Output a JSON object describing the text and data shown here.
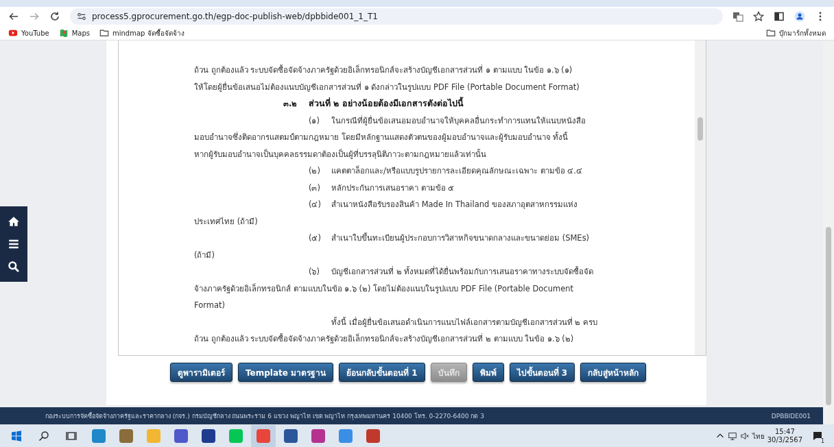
{
  "browser": {
    "url": "process5.gprocurement.go.th/egp-doc-publish-web/dpbbide001_1_T1",
    "bookmarks": [
      {
        "label": "YouTube",
        "kind": "youtube"
      },
      {
        "label": "Maps",
        "kind": "maps"
      },
      {
        "label": "mindmap จัดซื้อจัดจ้าง",
        "kind": "folder"
      }
    ],
    "all_bookmarks": "บุ๊กมาร์กทั้งหมด"
  },
  "document": {
    "lines": [
      {
        "kind": "flush",
        "text": "ถ้วน ถูกต้องแล้ว ระบบจัดซื้อจัดจ้างภาครัฐด้วยอิเล็กทรอนิกส์จะสร้างบัญชีเอกสารส่วนที่ ๑ ตามแบบ ในข้อ ๑.๖ (๑)"
      },
      {
        "kind": "flush",
        "text": "ให้โดยผู้ยื่นข้อเสนอไม่ต้องแนบบัญชีเอกสารส่วนที่ ๑ ดังกล่าวในรูปแบบ PDF File (Portable Document Format)"
      },
      {
        "kind": "heading",
        "number": "๓.๒",
        "text": "ส่วนที่ ๒ อย่างน้อยต้องมีเอกสารดังต่อไปนี้"
      },
      {
        "kind": "item",
        "number": "(๑)",
        "text": "ในกรณีที่ผู้ยื่นข้อเสนอมอบอำนาจให้บุคคลอื่นกระทำการแทนให้แนบหนังสือ"
      },
      {
        "kind": "flush",
        "text": "มอบอำนาจซึ่งติดอากรแสตมป์ตามกฎหมาย โดยมีหลักฐานแสดงตัวตนของผู้มอบอำนาจและผู้รับมอบอำนาจ ทั้งนี้"
      },
      {
        "kind": "flush",
        "text": "หากผู้รับมอบอำนาจเป็นบุคคลธรรมดาต้องเป็นผู้ที่บรรลุนิติภาวะตามกฎหมายแล้วเท่านั้น"
      },
      {
        "kind": "item",
        "number": "(๒)",
        "text": "แคตตาล็อกและ/หรือแบบรูปรายการละเอียดคุณลักษณะเฉพาะ ตามข้อ ๔.๔"
      },
      {
        "kind": "item",
        "number": "(๓)",
        "text": "หลักประกันการเสนอราคา ตามข้อ ๕"
      },
      {
        "kind": "item",
        "number": "(๔)",
        "text": "สำเนาหนังสือรับรองสินค้า Made In Thailand ของสภาอุตสาหกรรมแห่ง"
      },
      {
        "kind": "flush",
        "text": "ประเทศไทย (ถ้ามี)"
      },
      {
        "kind": "item",
        "number": "(๕)",
        "text": "สำเนาใบขึ้นทะเบียนผู้ประกอบการวิสาหกิจขนาดกลางและขนาดย่อม (SMEs)"
      },
      {
        "kind": "flush",
        "text": "(ถ้ามี)"
      },
      {
        "kind": "item",
        "number": "(๖)",
        "text": "บัญชีเอกสารส่วนที่ ๒ ทั้งหมดที่ได้ยื่นพร้อมกับการเสนอราคาทางระบบจัดซื้อจัด"
      },
      {
        "kind": "flush",
        "text": "จ้างภาครัฐด้วยอิเล็กทรอนิกส์ ตามแบบในข้อ ๑.๖ (๒) โดยไม่ต้องแนบในรูปแบบ PDF File (Portable Document"
      },
      {
        "kind": "flush",
        "text": "Format)"
      },
      {
        "kind": "indent",
        "text": "ทั้งนี้ เมื่อผู้ยื่นข้อเสนอดำเนินการแนบไฟล์เอกสารตามบัญชีเอกสารส่วนที่ ๒ ครบ"
      },
      {
        "kind": "flush",
        "text": "ถ้วน ถูกต้องแล้ว ระบบจัดซื้อจัดจ้างภาครัฐด้วยอิเล็กทรอนิกส์จะสร้างบัญชีเอกสารส่วนที่ ๒ ตามแบบ ในข้อ ๑.๖ (๒)"
      }
    ]
  },
  "buttons": [
    {
      "label": "ดูพารามิเตอร์",
      "disabled": false
    },
    {
      "label": "Template มาตรฐาน",
      "disabled": false
    },
    {
      "label": "ย้อนกลับขั้นตอนที่ 1",
      "disabled": false
    },
    {
      "label": "บันทึก",
      "disabled": true
    },
    {
      "label": "พิมพ์",
      "disabled": false
    },
    {
      "label": "ไปขั้นตอนที่ 3",
      "disabled": false
    },
    {
      "label": "กลับสู่หน้าหลัก",
      "disabled": false
    }
  ],
  "footer": {
    "address": "กองระบบการจัดซื้อจัดจ้างภาครัฐและราคากลาง (กจร.) กรมบัญชีกลาง ถนนพระราม 6 แขวง พญาไท เขต พญาไท กรุงเทพมหานคร 10400 โทร. 0-2270-6400 กด 3",
    "code": "DPBBIDE001"
  },
  "taskbar": {
    "apps": [
      {
        "color": "#1e88c8",
        "selected": false
      },
      {
        "color": "#8a6d3b",
        "selected": false
      },
      {
        "color": "#f2b632",
        "selected": false
      },
      {
        "color": "#5059c9",
        "selected": false
      },
      {
        "color": "#1f3b8f",
        "selected": false
      },
      {
        "color": "#06c755",
        "selected": false
      },
      {
        "color": "#e8453c",
        "selected": true
      },
      {
        "color": "#2b579a",
        "selected": false
      },
      {
        "color": "#b5328f",
        "selected": false
      },
      {
        "color": "#3a8ee6",
        "selected": false
      },
      {
        "color": "#c0392b",
        "selected": false
      }
    ],
    "language": "ไทย",
    "time": "15:47",
    "date": "30/3/2567",
    "notifications": "1"
  }
}
